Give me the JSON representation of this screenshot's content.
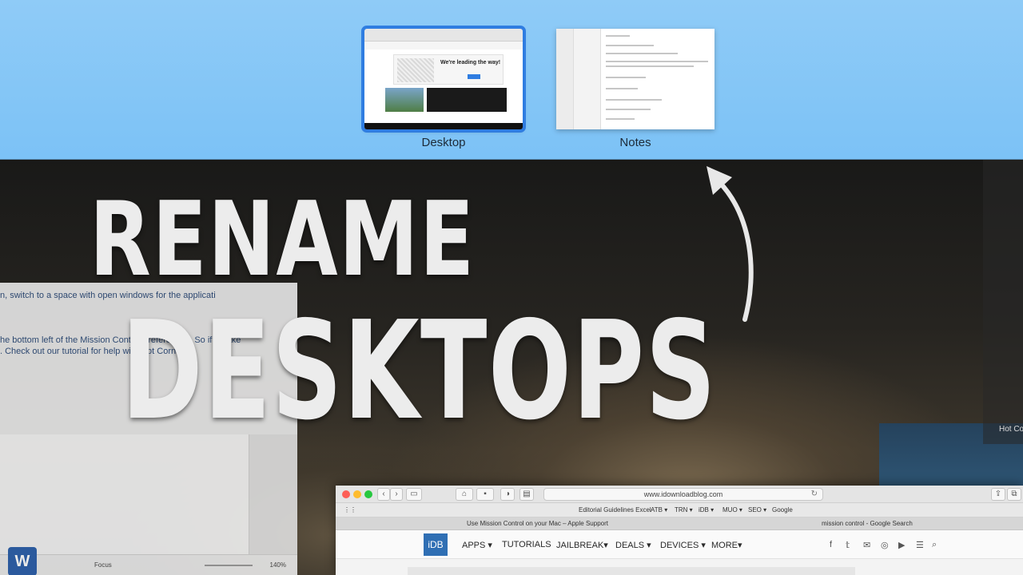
{
  "spaces": [
    {
      "label": "Desktop",
      "selected": true,
      "preview_headline": "We're leading the way!"
    },
    {
      "label": "Notes",
      "selected": false
    }
  ],
  "headline": {
    "line1": "RENAME",
    "line2": "DESKTOPS"
  },
  "word_window": {
    "text_fragments": [
      "n, switch to a space with open windows for the applicati",
      "he bottom left of the Mission Control preferences. So if I make",
      ". Check out our tutorial for help with Hot Corners."
    ],
    "app_icon": "W",
    "focus_label": "Focus",
    "zoom": "140%"
  },
  "right_panel": {
    "hot_corners_label": "Hot Cor"
  },
  "safari": {
    "url": "www.idownloadblog.com",
    "favorites": [
      "Editorial Guidelines Excel",
      "ATB ▾",
      "TRN ▾",
      "iDB ▾",
      "MUO ▾",
      "SEO ▾",
      "Google"
    ],
    "tabs": [
      "Use Mission Control on your Mac – Apple Support",
      "mission control - Google Search"
    ],
    "logo": "iDB",
    "nav": [
      "APPS ▾",
      "TUTORIALS",
      "JAILBREAK▾",
      "DEALS ▾",
      "DEVICES ▾",
      "MORE▾"
    ],
    "social_icons": [
      "f",
      "𝕥",
      "✉",
      "◎",
      "▶",
      "☰",
      "⌕"
    ]
  },
  "colors": {
    "accent_blue": "#2f7de1",
    "spaces_bar": "#8fcbf7",
    "idb_blue": "#2f6fb4"
  }
}
